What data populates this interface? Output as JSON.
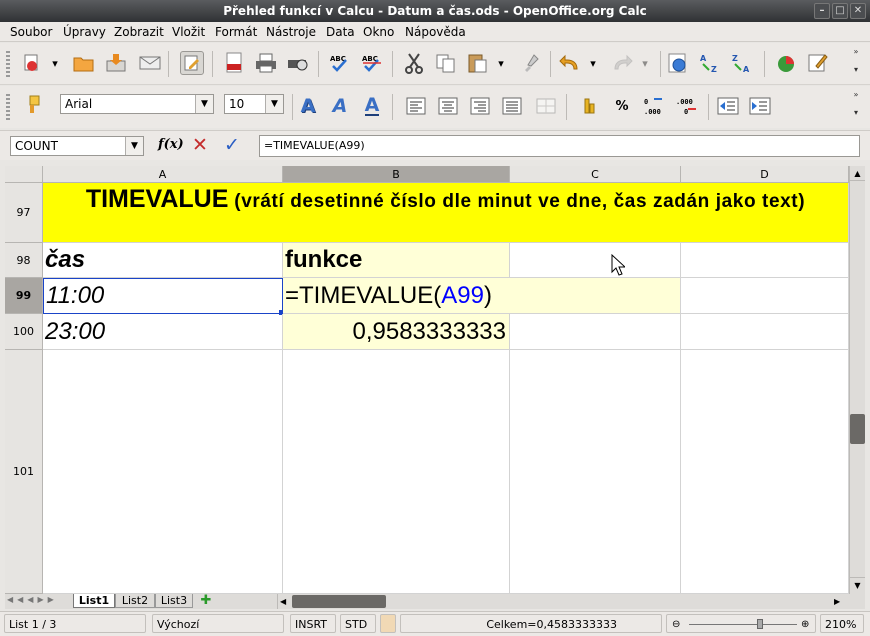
{
  "window": {
    "title": "Přehled funkcí v Calcu - Datum a čas.ods - OpenOffice.org Calc"
  },
  "menu": [
    "Soubor",
    "Úpravy",
    "Zobrazit",
    "Vložit",
    "Formát",
    "Nástroje",
    "Data",
    "Okno",
    "Nápověda"
  ],
  "format": {
    "font": "Arial",
    "size": "10"
  },
  "formula_bar": {
    "name_box": "COUNT",
    "fx_label": "f(x)",
    "formula": "=TIMEVALUE(A99)"
  },
  "columns": [
    "A",
    "B",
    "C",
    "D"
  ],
  "rows": [
    "97",
    "98",
    "99",
    "100",
    "101"
  ],
  "cells": {
    "a97": "TIMEVALUE",
    "a97_rest": " (vrátí desetinné číslo dle minut ve dne, čas zadán jako text)",
    "a98": "čas",
    "b98": "funkce",
    "a99": "11:00",
    "b99_pre": "=TIMEVALUE(",
    "b99_ref": "A99",
    "b99_post": ")",
    "a100": "23:00",
    "b100": "0,9583333333"
  },
  "sheet_tabs": [
    "List1",
    "List2",
    "List3"
  ],
  "status": {
    "sheet": "List 1 / 3",
    "style": "Výchozí",
    "mode": "INSRT",
    "sel": "STD",
    "sum": "Celkem=0,4583333333",
    "zoom": "210%"
  },
  "colors": {
    "highlight": "#ffff00",
    "pale": "#ffffd7",
    "ref_blue": "#0000ff"
  }
}
